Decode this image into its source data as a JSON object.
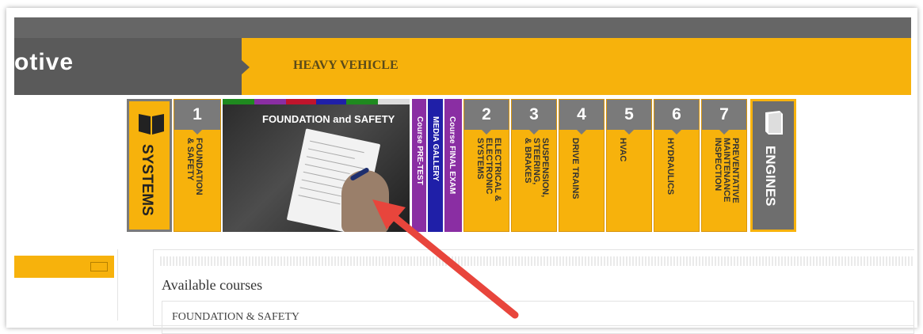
{
  "header": {
    "brand_text": "otive",
    "section_label": "HEAVY VEHICLE"
  },
  "menu": {
    "systems": {
      "label": "SYSTEMS",
      "icon": "book-open-icon"
    },
    "foundation": {
      "number": "1",
      "label": "FOUNDATION\n& SAFETY"
    },
    "photo": {
      "title": "FOUNDATION and SAFETY",
      "stripe_colors": [
        "#1f8a1f",
        "#8a2ea3",
        "#c0142c",
        "#1f1fa8",
        "#1f8a1f",
        "#e0e0e0"
      ]
    },
    "pre_test": "Course PRE-TEST",
    "media_gallery": "MEDIA GALLERY",
    "final_exam": "Course FINAL EXAM",
    "modules": [
      {
        "number": "2",
        "label": "ELECTRICAL &\nELECTRONIC\nSYSTEMS"
      },
      {
        "number": "3",
        "label": "SUSPENSION,\nSTEERING,\n& BRAKES"
      },
      {
        "number": "4",
        "label": "DRIVE TRAINS"
      },
      {
        "number": "5",
        "label": "HVAC"
      },
      {
        "number": "6",
        "label": "HYDRAULICS"
      },
      {
        "number": "7",
        "label": "PREVENTATIVE\nMAINTENANCE\nINSPECTION"
      }
    ],
    "engines": {
      "label": "ENGINES",
      "icon": "book-closed-icon"
    }
  },
  "content": {
    "heading": "Available courses",
    "course_item": "FOUNDATION & SAFETY"
  },
  "colors": {
    "accent": "#f7b20c",
    "gray": "#7a7a7a",
    "purple": "#8a2ea3",
    "blue": "#1f1fa8",
    "annotation_arrow": "#e8453c"
  }
}
